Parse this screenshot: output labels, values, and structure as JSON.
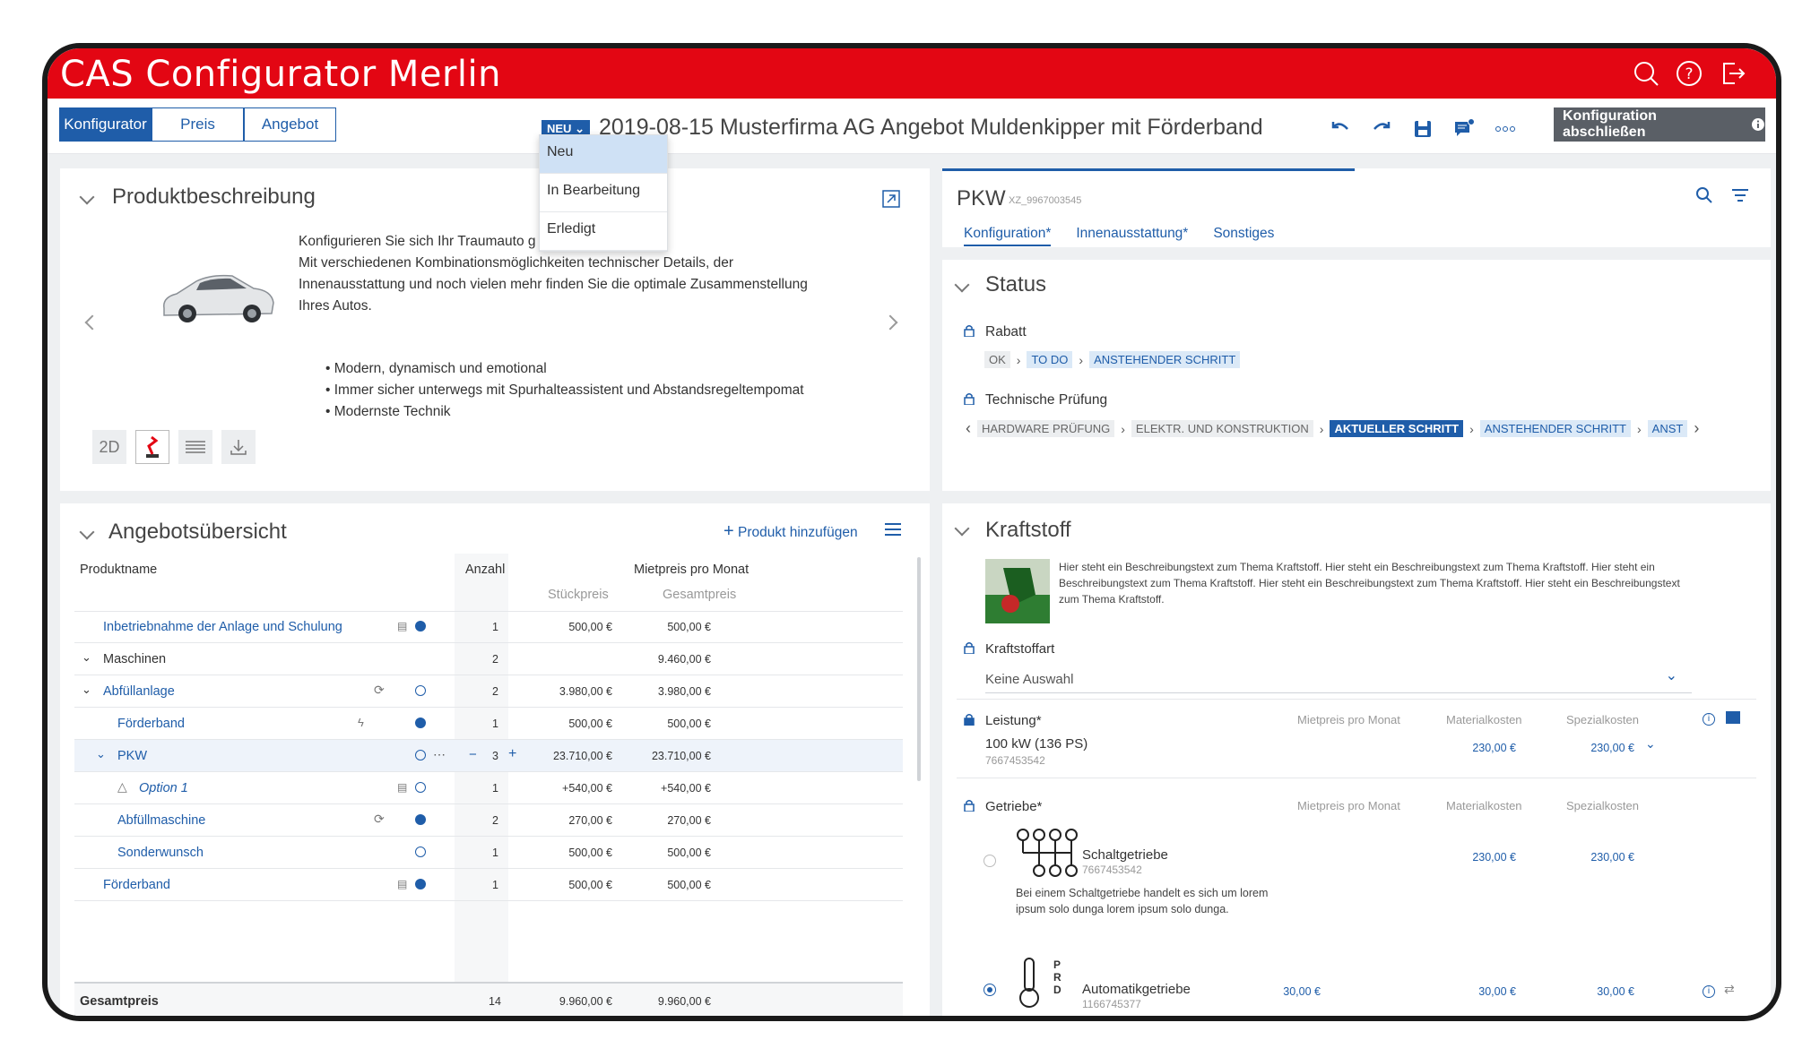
{
  "app": {
    "title": "CAS Configurator Merlin"
  },
  "tabs": [
    {
      "label": "Konfigurator"
    },
    {
      "label": "Preis"
    },
    {
      "label": "Angebot"
    }
  ],
  "status_pill": "NEU",
  "doc_title": "2019-08-15 Musterfirma AG Angebot Muldenkipper mit Förderband",
  "finish_button": "Konfiguration abschließen",
  "status_dropdown": [
    "Neu",
    "In Bearbeitung",
    "Erledigt"
  ],
  "produkt": {
    "title": "Produktbeschreibung",
    "text_lines": [
      "Konfigurieren Sie sich Ihr Traumauto g",
      "Mit verschiedenen Kombinationsmöglichkeiten technischer Details, der",
      "Innenausstattung und noch vielen mehr finden Sie die optimale Zusammenstellung",
      "Ihres Autos."
    ],
    "bullets": [
      "Modern, dynamisch und emotional",
      "Immer sicher unterwegs mit Spurhalteassistent und Abstandsregeltempomat",
      "Modernste Technik"
    ],
    "view_2d": "2D"
  },
  "pkw": {
    "title": "PKW",
    "code": "XZ_9967003545",
    "tabs": [
      "Konfiguration*",
      "Innenausstattung*",
      "Sonstiges"
    ]
  },
  "status": {
    "title": "Status",
    "rabatt_label": "Rabatt",
    "rabatt_steps": [
      "OK",
      "TO DO",
      "ANSTEHENDER SCHRITT"
    ],
    "pruefung_label": "Technische Prüfung",
    "pruefung_steps": [
      "HARDWARE PRÜFUNG",
      "ELEKTR. UND KONSTRUKTION",
      "AKTUELLER SCHRITT",
      "ANSTEHENDER SCHRITT",
      "ANST"
    ]
  },
  "angebot": {
    "title": "Angebotsübersicht",
    "add_label": "Produkt hinzufügen",
    "col_produkt": "Produktname",
    "col_anzahl": "Anzahl",
    "col_mietpreis": "Mietpreis pro Monat",
    "col_stueck": "Stückpreis",
    "col_gesamt": "Gesamtpreis",
    "rows": [
      {
        "name": "Inbetriebnahme der Anlage und Schulung",
        "anzahl": "1",
        "stueck": "500,00 €",
        "gesamt": "500,00 €"
      },
      {
        "name": "Maschinen",
        "anzahl": "2",
        "stueck": "",
        "gesamt": "9.460,00 €"
      },
      {
        "name": "Abfüllanlage",
        "anzahl": "2",
        "stueck": "3.980,00 €",
        "gesamt": "3.980,00 €"
      },
      {
        "name": "Förderband",
        "anzahl": "1",
        "stueck": "500,00 €",
        "gesamt": "500,00 €"
      },
      {
        "name": "PKW",
        "anzahl": "3",
        "stueck": "23.710,00 €",
        "gesamt": "23.710,00 €"
      },
      {
        "name": "Option 1",
        "anzahl": "1",
        "stueck": "+540,00 €",
        "gesamt": "+540,00 €"
      },
      {
        "name": "Abfüllmaschine",
        "anzahl": "2",
        "stueck": "270,00 €",
        "gesamt": "270,00 €"
      },
      {
        "name": "Sonderwunsch",
        "anzahl": "1",
        "stueck": "500,00 €",
        "gesamt": "500,00 €"
      },
      {
        "name": "Förderband",
        "anzahl": "1",
        "stueck": "500,00 €",
        "gesamt": "500,00 €"
      }
    ],
    "total_label": "Gesamtpreis",
    "total_anzahl": "14",
    "total_stueck": "9.960,00 €",
    "total_gesamt": "9.960,00 €"
  },
  "kraftstoff": {
    "title": "Kraftstoff",
    "description": "Hier steht ein Beschreibungstext zum Thema Kraftstoff. Hier steht ein Beschreibungstext zum Thema Kraftstoff. Hier steht ein Beschreibungstext zum Thema Kraftstoff. Hier steht ein Beschreibungstext zum Thema Kraftstoff. Hier steht ein Beschreibungstext zum Thema Kraftstoff.",
    "art_label": "Kraftstoffart",
    "art_value": "Keine Auswahl",
    "leistung_label": "Leistung*",
    "col_mietpreis": "Mietpreis pro Monat",
    "col_material": "Materialkosten",
    "col_spezial": "Spezialkosten",
    "leistung_value": "100 kW (136 PS)",
    "leistung_code": "7667453542",
    "leistung_material": "230,00 €",
    "leistung_spezial": "230,00 €",
    "getriebe_label": "Getriebe*",
    "schalt_name": "Schaltgetriebe",
    "schalt_code": "7667453542",
    "schalt_material": "230,00 €",
    "schalt_spezial": "230,00 €",
    "schalt_desc": "Bei einem Schaltgetriebe handelt es sich um lorem ipsum solo dunga lorem ipsum solo dunga.",
    "auto_name": "Automatikgetriebe",
    "auto_code": "1166745377",
    "auto_miet": "30,00 €",
    "auto_material": "30,00 €",
    "auto_spezial": "30,00 €",
    "auto_shift": "P R D"
  }
}
